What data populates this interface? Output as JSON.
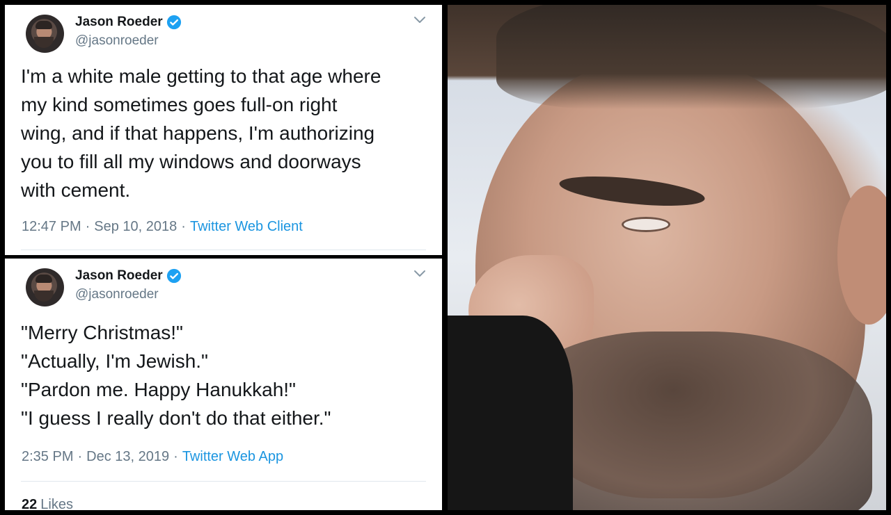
{
  "tweets": [
    {
      "display_name": "Jason Roeder",
      "handle": "@jasonroeder",
      "text_lines": [
        "I'm a white male getting to that age where",
        "my kind sometimes goes full-on right",
        "wing, and if that happens, I'm authorizing",
        "you to fill all my windows and doorways",
        "with cement."
      ],
      "time": "12:47 PM",
      "date": "Sep 10, 2018",
      "client": "Twitter Web Client"
    },
    {
      "display_name": "Jason Roeder",
      "handle": "@jasonroeder",
      "text_lines": [
        "\"Merry Christmas!\"",
        "\"Actually, I'm Jewish.\"",
        "\"Pardon me. Happy Hanukkah!\"",
        "\"I guess I really don't do that either.\""
      ],
      "time": "2:35 PM",
      "date": "Dec 13, 2019",
      "client": "Twitter Web App",
      "likes_count": "22",
      "likes_label": "Likes"
    }
  ],
  "separator": "·",
  "icons": {
    "verified": "verified-badge-icon",
    "menu": "chevron-down-icon"
  },
  "colors": {
    "link": "#1b95e0",
    "verified": "#1da1f2",
    "muted": "#657786",
    "text": "#14171a"
  }
}
